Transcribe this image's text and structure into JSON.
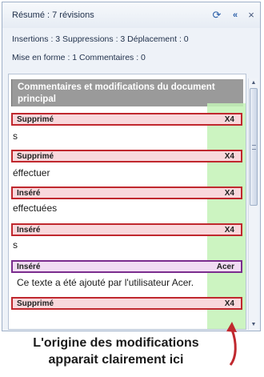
{
  "pane": {
    "title": "Résumé : 7 révisions",
    "summary_line1": "Insertions : 3  Suppressions : 3  Déplacement : 0",
    "summary_line2": "Mise en forme : 1  Commentaires : 0",
    "icons": {
      "refresh": "refresh-icon",
      "collapse": "collapse-icon",
      "close": "close-icon"
    }
  },
  "section_header": "Commentaires et modifications du document principal",
  "revisions": [
    {
      "type": "Supprimé",
      "author": "X4",
      "text": "s",
      "color": "red"
    },
    {
      "type": "Supprimé",
      "author": "X4",
      "text": "éffectuer",
      "color": "red"
    },
    {
      "type": "Inséré",
      "author": "X4",
      "text": "effectuées",
      "color": "red"
    },
    {
      "type": "Inséré",
      "author": "X4",
      "text": "s",
      "color": "red"
    },
    {
      "type": "Inséré",
      "author": "Acer",
      "text": "Ce texte a été ajouté par l'utilisateur Acer.",
      "color": "purple"
    },
    {
      "type": "Supprimé",
      "author": "X4",
      "text": "",
      "color": "red"
    }
  ],
  "colors": {
    "revision_red": "#c0282e",
    "revision_purple": "#7b2d8e",
    "author_highlight": "#c3f2b6",
    "arrow": "#c0282e"
  },
  "callout": {
    "line1": "L'origine des modifications",
    "line2": "apparait clairement ici"
  }
}
